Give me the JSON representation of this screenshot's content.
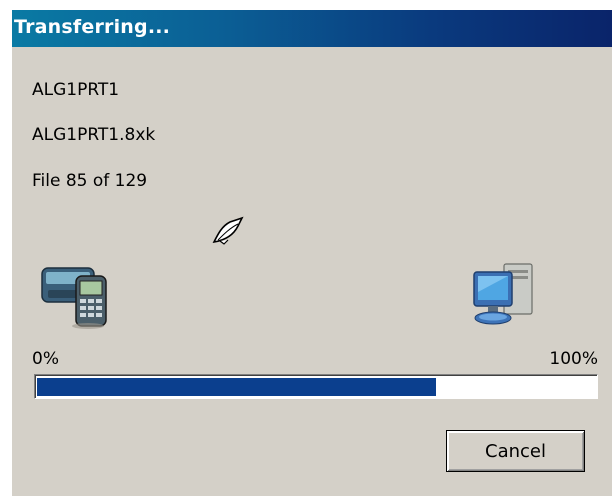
{
  "dialog": {
    "title": "Transferring...",
    "source_name": "ALG1PRT1",
    "file_name": "ALG1PRT1.8xk",
    "file_count": "File 85 of 129"
  },
  "icons": {
    "source": "calculator-device-icon",
    "destination": "computer-icon",
    "transfer": "flying-paper-icon"
  },
  "progress": {
    "min_label": "0%",
    "max_label": "100%",
    "fraction": 0.715,
    "fill_color": "#0b3f8e"
  },
  "buttons": {
    "cancel_label": "Cancel"
  },
  "colors": {
    "titlebar_start": "#0a7aa4",
    "titlebar_end": "#0a246a",
    "dialog_bg": "#d4d0c8"
  }
}
